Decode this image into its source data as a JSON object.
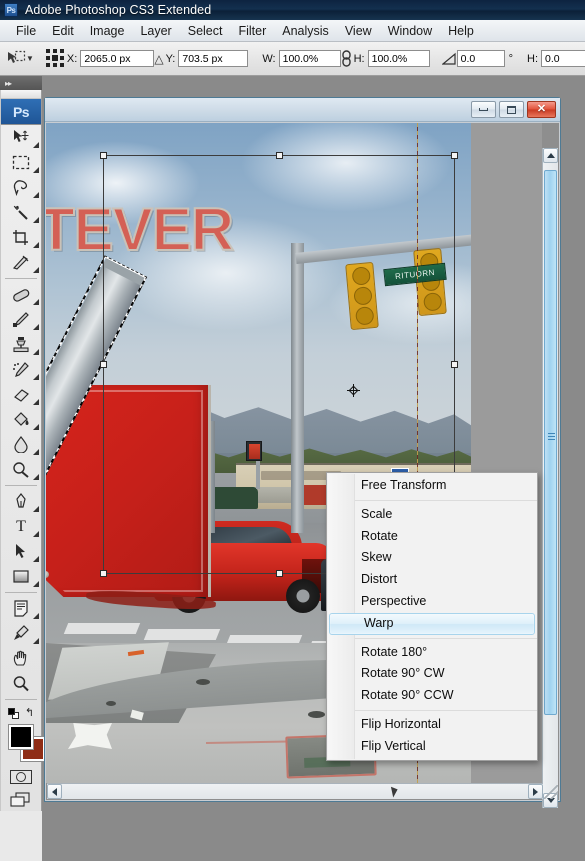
{
  "app": {
    "title": "Adobe Photoshop CS3 Extended",
    "logo": "Ps"
  },
  "menubar": {
    "items": [
      {
        "label": "File"
      },
      {
        "label": "Edit"
      },
      {
        "label": "Image"
      },
      {
        "label": "Layer"
      },
      {
        "label": "Select"
      },
      {
        "label": "Filter"
      },
      {
        "label": "Analysis"
      },
      {
        "label": "View"
      },
      {
        "label": "Window"
      },
      {
        "label": "Help"
      }
    ]
  },
  "options_bar": {
    "tool": "move-tool",
    "reference_point_label": "reference-point-locator",
    "x_label": "X:",
    "x_value": "2065.0 px",
    "delta_symbol": "△",
    "y_label": "Y:",
    "y_value": "703.5 px",
    "w_label": "W:",
    "w_value": "100.0%",
    "link_icon": "link-chain-icon",
    "h_label": "H:",
    "h_value": "100.0%",
    "angle_icon": "angle-icon",
    "angle_value": "0.0",
    "degree_symbol": "°",
    "h2_label": "H:",
    "h2_value": "0.0"
  },
  "toolbar": {
    "collapse_label": "▸▸",
    "logo": "Ps",
    "tools": [
      {
        "name": "move-tool",
        "glyph": "move"
      },
      {
        "name": "marquee-tool",
        "glyph": "marquee"
      },
      {
        "name": "lasso-tool",
        "glyph": "lasso"
      },
      {
        "name": "magic-wand-tool",
        "glyph": "wand"
      },
      {
        "name": "crop-tool",
        "glyph": "crop"
      },
      {
        "name": "slice-tool",
        "glyph": "slice"
      },
      {
        "name": "healing-brush-tool",
        "glyph": "bandage"
      },
      {
        "name": "brush-tool",
        "glyph": "brush"
      },
      {
        "name": "clone-stamp-tool",
        "glyph": "stamp"
      },
      {
        "name": "history-brush-tool",
        "glyph": "history-brush"
      },
      {
        "name": "eraser-tool",
        "glyph": "eraser"
      },
      {
        "name": "gradient-tool",
        "glyph": "paint-bucket"
      },
      {
        "name": "blur-tool",
        "glyph": "droplet"
      },
      {
        "name": "dodge-tool",
        "glyph": "dodge"
      },
      {
        "name": "pen-tool",
        "glyph": "pen"
      },
      {
        "name": "type-tool",
        "glyph": "T"
      },
      {
        "name": "path-selection-tool",
        "glyph": "arrow"
      },
      {
        "name": "shape-tool",
        "glyph": "rectangle"
      },
      {
        "name": "notes-tool",
        "glyph": "note"
      },
      {
        "name": "eyedropper-tool",
        "glyph": "eyedropper"
      },
      {
        "name": "hand-tool",
        "glyph": "hand"
      },
      {
        "name": "zoom-tool",
        "glyph": "magnifier"
      }
    ],
    "foreground_color": "#000000",
    "background_color": "#8f2d16",
    "default_colors_label": "default-foreground-background-colors",
    "swap_colors_label": "↰",
    "quick_mask_label": "edit-in-quick-mask-mode",
    "screen_mode_label": "change-screen-mode"
  },
  "document_window": {
    "minimize_label": "–",
    "maximize_label": "□",
    "close_label": "✕"
  },
  "canvas": {
    "stop_sign_text": "TEVER",
    "street_sign_text": "RITUORN",
    "guide_label": "vertical-guide",
    "selection_label": "marching-ants-selection",
    "transform_box_label": "free-transform-bounding-box",
    "reference_point_label": "transform-reference-point"
  },
  "context_menu": {
    "groups": [
      {
        "items": [
          {
            "label": "Free Transform",
            "selected": false
          }
        ]
      },
      {
        "items": [
          {
            "label": "Scale",
            "selected": false
          },
          {
            "label": "Rotate",
            "selected": false
          },
          {
            "label": "Skew",
            "selected": false
          },
          {
            "label": "Distort",
            "selected": false
          },
          {
            "label": "Perspective",
            "selected": false
          },
          {
            "label": "Warp",
            "selected": true
          }
        ]
      },
      {
        "items": [
          {
            "label": "Rotate 180°",
            "selected": false
          },
          {
            "label": "Rotate 90° CW",
            "selected": false
          },
          {
            "label": "Rotate 90° CCW",
            "selected": false
          }
        ]
      },
      {
        "items": [
          {
            "label": "Flip Horizontal",
            "selected": false
          },
          {
            "label": "Flip Vertical",
            "selected": false
          }
        ]
      }
    ],
    "highlight_color": "#cfe8f7"
  }
}
